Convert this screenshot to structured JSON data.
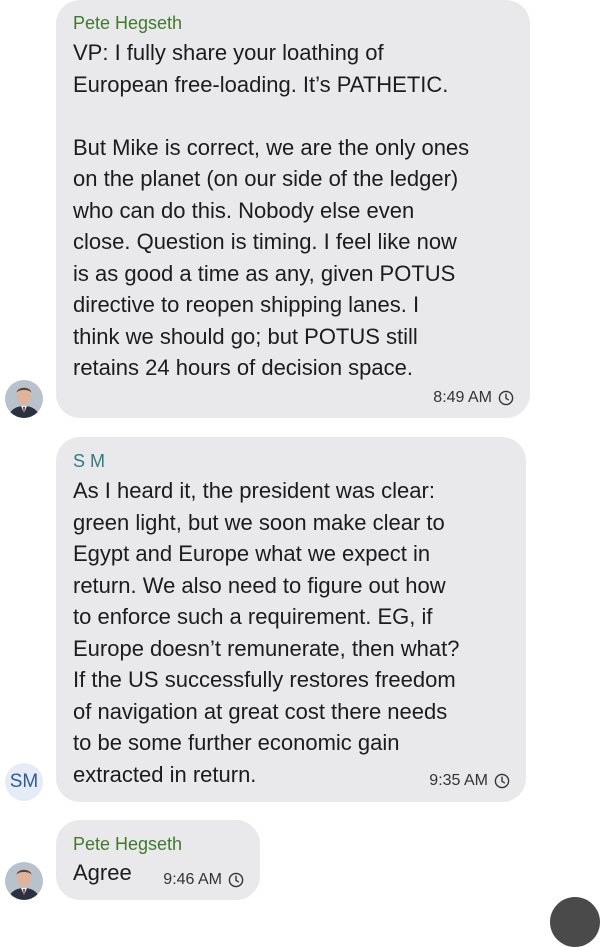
{
  "colors": {
    "bubble_bg": "#e9e9eb",
    "sender_green": "#3f7a2b",
    "sender_teal": "#2f7d80",
    "sm_avatar_bg": "#e5ecf6",
    "sm_avatar_text": "#2e5a96"
  },
  "messages": [
    {
      "sender": "Pete Hegseth",
      "sender_color": "green",
      "avatar": "person-photo-icon",
      "text": "VP: I fully share your loathing of\nEuropean free-loading. It’s PATHETIC.\n\nBut Mike is correct, we are the only ones\non the planet (on our side of the ledger)\nwho can do this. Nobody else even\nclose. Question is timing. I feel like now\nis as good a time as any, given POTUS\ndirective to reopen shipping lanes. I\nthink we should go; but POTUS still\nretains 24 hours of decision space.",
      "time": "8:49 AM",
      "status_icon": "clock-icon"
    },
    {
      "sender": "S M",
      "sender_color": "teal",
      "avatar_initials": "SM",
      "text": "As I heard it, the president was clear:\ngreen light, but we soon make clear to\nEgypt and Europe what we expect in\nreturn. We also need to figure out how\nto enforce such a requirement. EG, if\nEurope doesn’t remunerate, then what?\nIf the US successfully restores freedom\nof navigation at great cost there needs\nto be some further economic gain\nextracted in return.",
      "time": "9:35 AM",
      "status_icon": "clock-icon"
    },
    {
      "sender": "Pete Hegseth",
      "sender_color": "green",
      "avatar": "person-photo-icon",
      "text": "Agree",
      "time": "9:46 AM",
      "status_icon": "clock-icon"
    }
  ]
}
